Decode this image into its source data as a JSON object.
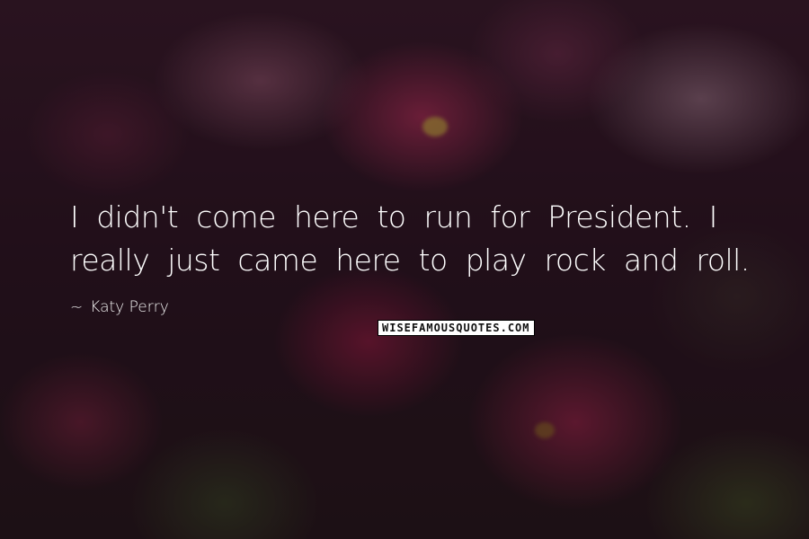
{
  "quote": {
    "text": "I didn't come here to run for President. I really just came here to play rock and roll.",
    "author": "Katy Perry",
    "dash": "~"
  },
  "watermark": {
    "text": "WISEFAMOUSQUOTES.COM"
  },
  "background": {
    "description_icon": "pink-flowers-photo"
  }
}
